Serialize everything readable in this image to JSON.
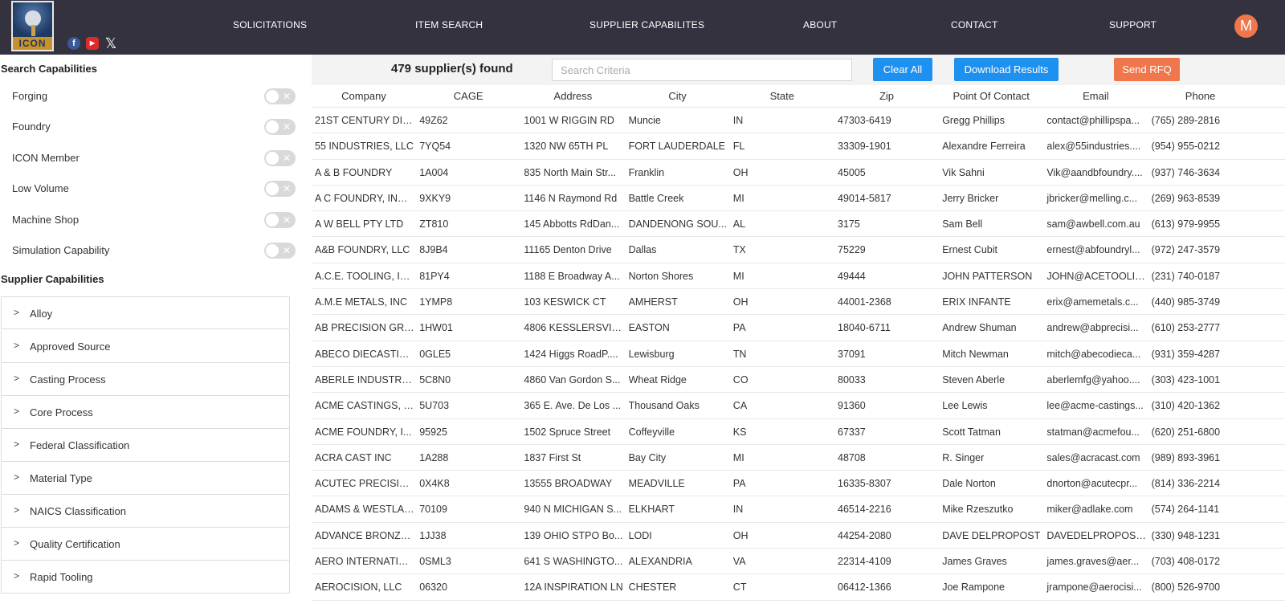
{
  "header": {
    "logo_text": "ICON",
    "social": {
      "facebook": "f",
      "youtube": "▶",
      "x": "𝕏"
    },
    "nav": [
      "SOLICITATIONS",
      "ITEM SEARCH",
      "SUPPLIER CAPABILITES",
      "ABOUT",
      "CONTACT",
      "SUPPORT"
    ],
    "avatar_initial": "M",
    "colors": {
      "bar": "#34323f",
      "avatar": "#f0764b"
    }
  },
  "sidebar": {
    "search_heading": "Search Capabilities",
    "toggles": [
      {
        "label": "Forging",
        "on": false
      },
      {
        "label": "Foundry",
        "on": false
      },
      {
        "label": "ICON Member",
        "on": false
      },
      {
        "label": "Low Volume",
        "on": false
      },
      {
        "label": "Machine Shop",
        "on": false
      },
      {
        "label": "Simulation Capability",
        "on": false
      }
    ],
    "supplier_heading": "Supplier Capabilities",
    "accordions": [
      "Alloy",
      "Approved Source",
      "Casting Process",
      "Core Process",
      "Federal Classification",
      "Material Type",
      "NAICS Classification",
      "Quality Certification",
      "Rapid Tooling"
    ],
    "chevron": ">",
    "toggle_x": "✕"
  },
  "toolbar": {
    "result_count": "479 supplier(s) found",
    "search_placeholder": "Search Criteria",
    "clear_label": "Clear All",
    "download_label": "Download Results",
    "rfq_label": "Send RFQ",
    "colors": {
      "primary": "#1e90f0",
      "rfq": "#f0764b"
    }
  },
  "table": {
    "columns": [
      "Company",
      "CAGE",
      "Address",
      "City",
      "State",
      "Zip",
      "Point Of Contact",
      "Email",
      "Phone"
    ],
    "rows": [
      [
        "21ST CENTURY DIE ...",
        "49Z62",
        "1001 W RIGGIN RD",
        "Muncie",
        "IN",
        "47303-6419",
        "Gregg Phillips",
        "contact@phillipspa...",
        "(765) 289-2816"
      ],
      [
        "55 INDUSTRIES, LLC",
        "7YQ54",
        "1320 NW 65TH PL",
        "FORT LAUDERDALE",
        "FL",
        "33309-1901",
        "Alexandre Ferreira",
        "alex@55industries....",
        "(954) 955-0212"
      ],
      [
        "A & B FOUNDRY",
        "1A004",
        "835 North Main Str...",
        "Franklin",
        "OH",
        "45005",
        "Vik Sahni",
        "Vik@aandbfoundry....",
        "(937) 746-3634"
      ],
      [
        "A C FOUNDRY, INC....",
        "9XKY9",
        "1146 N Raymond Rd",
        "Battle Creek",
        "MI",
        "49014-5817",
        "Jerry Bricker",
        "jbricker@melling.c...",
        "(269) 963-8539"
      ],
      [
        "A W BELL PTY LTD",
        "ZT810",
        "145 Abbotts RdDan...",
        "DANDENONG SOU...",
        "AL",
        "3175",
        "Sam Bell",
        "sam@awbell.com.au",
        "(613) 979-9955"
      ],
      [
        "A&B FOUNDRY, LLC",
        "8J9B4",
        "11165 Denton Drive",
        "Dallas",
        "TX",
        "75229",
        "Ernest Cubit",
        "ernest@abfoundryl...",
        "(972) 247-3579"
      ],
      [
        "A.C.E. TOOLING, INC.",
        "81PY4",
        "1188 E Broadway A...",
        "Norton Shores",
        "MI",
        "49444",
        "JOHN PATTERSON",
        "JOHN@ACETOOLIN...",
        "(231) 740-0187"
      ],
      [
        "A.M.E METALS, INC",
        "1YMP8",
        "103 KESWICK CT",
        "AMHERST",
        "OH",
        "44001-2368",
        "ERIX INFANTE",
        "erix@amemetals.c...",
        "(440) 985-3749"
      ],
      [
        "AB PRECISION GRI...",
        "1HW01",
        "4806 KESSLERSVILL...",
        "EASTON",
        "PA",
        "18040-6711",
        "Andrew Shuman",
        "andrew@abprecisi...",
        "(610) 253-2777"
      ],
      [
        "ABECO DIECASTIN...",
        "0GLE5",
        "1424 Higgs RoadP....",
        "Lewisburg",
        "TN",
        "37091",
        "Mitch Newman",
        "mitch@abecodieca...",
        "(931) 359-4287"
      ],
      [
        "ABERLE INDUSTRIA...",
        "5C8N0",
        "4860 Van Gordon S...",
        "Wheat Ridge",
        "CO",
        "80033",
        "Steven Aberle",
        "aberlemfg@yahoo....",
        "(303) 423-1001"
      ],
      [
        "ACME CASTINGS, I...",
        "5U703",
        "365 E. Ave. De Los ...",
        "Thousand Oaks",
        "CA",
        "91360",
        "Lee Lewis",
        "lee@acme-castings...",
        "(310) 420-1362"
      ],
      [
        "ACME FOUNDRY, I...",
        "95925",
        "1502 Spruce Street",
        "Coffeyville",
        "KS",
        "67337",
        "Scott Tatman",
        "statman@acmefou...",
        "(620) 251-6800"
      ],
      [
        "ACRA CAST INC",
        "1A288",
        "1837 First St",
        "Bay City",
        "MI",
        "48708",
        "R. Singer",
        "sales@acracast.com",
        "(989) 893-3961"
      ],
      [
        "ACUTEC PRECISION...",
        "0X4K8",
        "13555 BROADWAY",
        "MEADVILLE",
        "PA",
        "16335-8307",
        "Dale Norton",
        "dnorton@acutecpr...",
        "(814) 336-2214"
      ],
      [
        "ADAMS & WESTLAK...",
        "70109",
        "940 N MICHIGAN S...",
        "ELKHART",
        "IN",
        "46514-2216",
        "Mike Rzeszutko",
        "miker@adlake.com",
        "(574) 264-1141"
      ],
      [
        "ADVANCE BRONZE ...",
        "1JJ38",
        "139 OHIO STPO Bo...",
        "LODI",
        "OH",
        "44254-2080",
        "DAVE DELPROPOST",
        "DAVEDELPROPOST...",
        "(330) 948-1231"
      ],
      [
        "AERO INTERNATIO...",
        "0SML3",
        "641 S WASHINGTO...",
        "ALEXANDRIA",
        "VA",
        "22314-4109",
        "James Graves",
        "james.graves@aer...",
        "(703) 408-0172"
      ],
      [
        "AEROCISION, LLC",
        "06320",
        "12A INSPIRATION LN",
        "CHESTER",
        "CT",
        "06412-1366",
        "Joe Rampone",
        "jrampone@aerocisi...",
        "(800) 526-9700"
      ]
    ]
  }
}
